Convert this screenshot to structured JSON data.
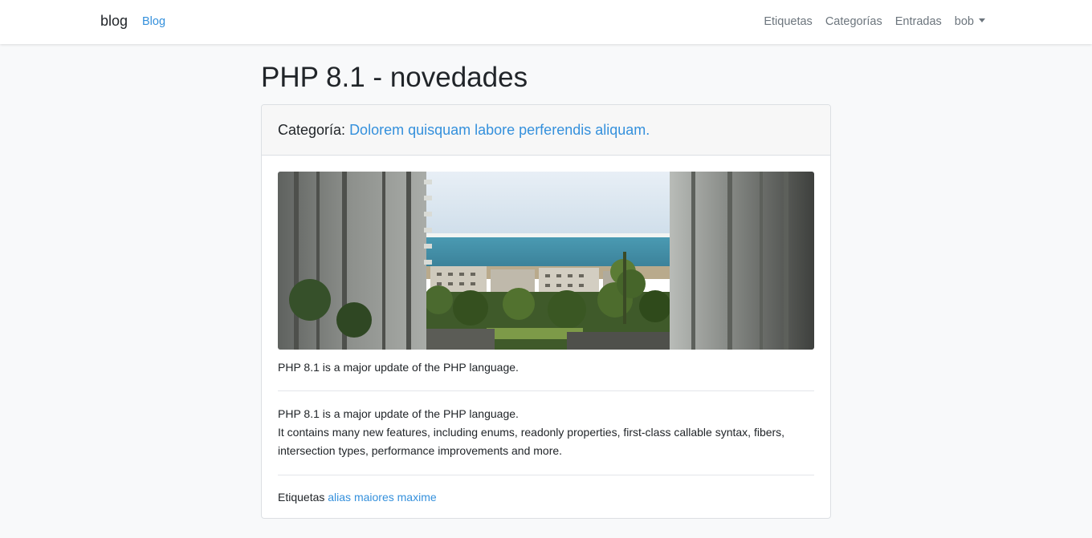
{
  "navbar": {
    "brand": "blog",
    "blog_link": "Blog",
    "right_links": [
      "Etiquetas",
      "Categorías",
      "Entradas"
    ],
    "user": "bob"
  },
  "post": {
    "title": "PHP 8.1 - novedades",
    "category_label": "Categoría:",
    "category": "Dolorem quisquam labore perferendis aliquam.",
    "excerpt": "PHP 8.1 is a major update of the PHP language.",
    "body_line1": "PHP 8.1 is a major update of the PHP language.",
    "body_line2": "It contains many new features, including enums, readonly properties, first-class callable syntax, fibers, intersection types, performance improvements and more.",
    "tags_label": "Etiquetas",
    "tags": [
      "alias",
      "maiores",
      "maxime"
    ]
  },
  "colors": {
    "link": "#3490dc",
    "muted": "#6c757d",
    "background": "#f8f9fa"
  }
}
